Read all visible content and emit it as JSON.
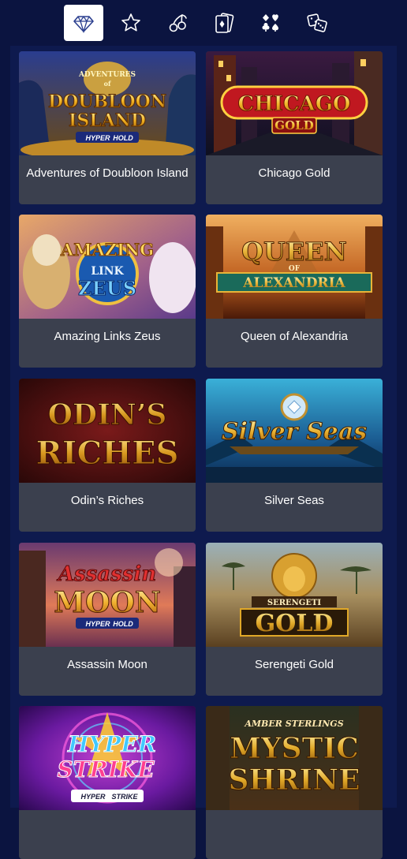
{
  "tabs": [
    {
      "icon": "diamond-icon",
      "active": true
    },
    {
      "icon": "star-icon",
      "active": false
    },
    {
      "icon": "cherries-icon",
      "active": false
    },
    {
      "icon": "playing-card-icon",
      "active": false
    },
    {
      "icon": "card-suits-icon",
      "active": false
    },
    {
      "icon": "dice-icon",
      "active": false
    }
  ],
  "colors": {
    "background": "#0b1440",
    "panel": "#0e1a4e",
    "card": "#3b404e",
    "active_tab": "#ffffff",
    "icon": "#ffffff"
  },
  "games": [
    {
      "title": "Adventures of Doubloon Island",
      "logo": {
        "small1": "ADVENTURES",
        "small2": "of",
        "line1": "DOUBLOON",
        "line2": "ISLAND",
        "badge1": "HYPER",
        "badge2": "HOLD"
      }
    },
    {
      "title": "Chicago Gold",
      "logo": {
        "line1": "CHICAGO",
        "line2": "GOLD"
      }
    },
    {
      "title": "Amazing Links Zeus",
      "logo": {
        "line1": "AMAZING",
        "line2": "LINK",
        "line3": "ZEUS"
      }
    },
    {
      "title": "Queen of Alexandria",
      "logo": {
        "line1": "QUEEN",
        "small": "OF",
        "line2": "ALEXANDRIA"
      }
    },
    {
      "title": "Odin’s Riches",
      "logo": {
        "line1": "ODIN’S",
        "line2": "RICHES"
      }
    },
    {
      "title": "Silver Seas",
      "logo": {
        "line1": "Silver Seas"
      }
    },
    {
      "title": "Assassin Moon",
      "logo": {
        "line1": "Assassin",
        "line2": "MOON",
        "badge1": "HYPER",
        "badge2": "HOLD"
      }
    },
    {
      "title": "Serengeti Gold",
      "logo": {
        "small": "SERENGETI",
        "line1": "GOLD"
      }
    },
    {
      "title": "",
      "logo": {
        "line1": "HYPER",
        "line2": "STRIKE",
        "badge1": "HYPER",
        "badge2": "STRIKE"
      }
    },
    {
      "title": "",
      "logo": {
        "small": "AMBER STERLINGS",
        "line1": "MYSTIC",
        "line2": "SHRINE"
      }
    }
  ]
}
